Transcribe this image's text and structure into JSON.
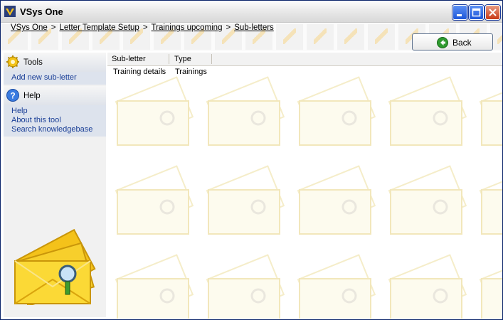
{
  "window": {
    "title": "VSys One",
    "icon": "vsys-app-icon",
    "controls": [
      "minimize-icon",
      "maximize-icon",
      "close-icon"
    ]
  },
  "breadcrumb": {
    "items": [
      "VSys One",
      "Letter Template Setup",
      "Trainings upcoming",
      "Sub-letters"
    ],
    "separator": ">"
  },
  "toolbar": {
    "back_label": "Back",
    "back_icon": "back-arrow-icon"
  },
  "sidebar": {
    "tools": {
      "title": "Tools",
      "icon": "tools-gear-icon",
      "links": [
        "Add new sub-letter"
      ]
    },
    "help": {
      "title": "Help",
      "icon": "help-question-icon",
      "links": [
        "Help",
        "About this tool",
        "Search knowledgebase"
      ]
    },
    "logo": "envelopes-magnifier-icon"
  },
  "list": {
    "columns": [
      "Sub-letter",
      "Type"
    ],
    "rows": [
      {
        "sub_letter": "Training details",
        "type": "Trainings"
      }
    ]
  },
  "colors": {
    "link": "#193e96",
    "panel_body": "#dde3ed",
    "accent_yellow": "#f6c21c",
    "back_green": "#2e9a2e"
  }
}
